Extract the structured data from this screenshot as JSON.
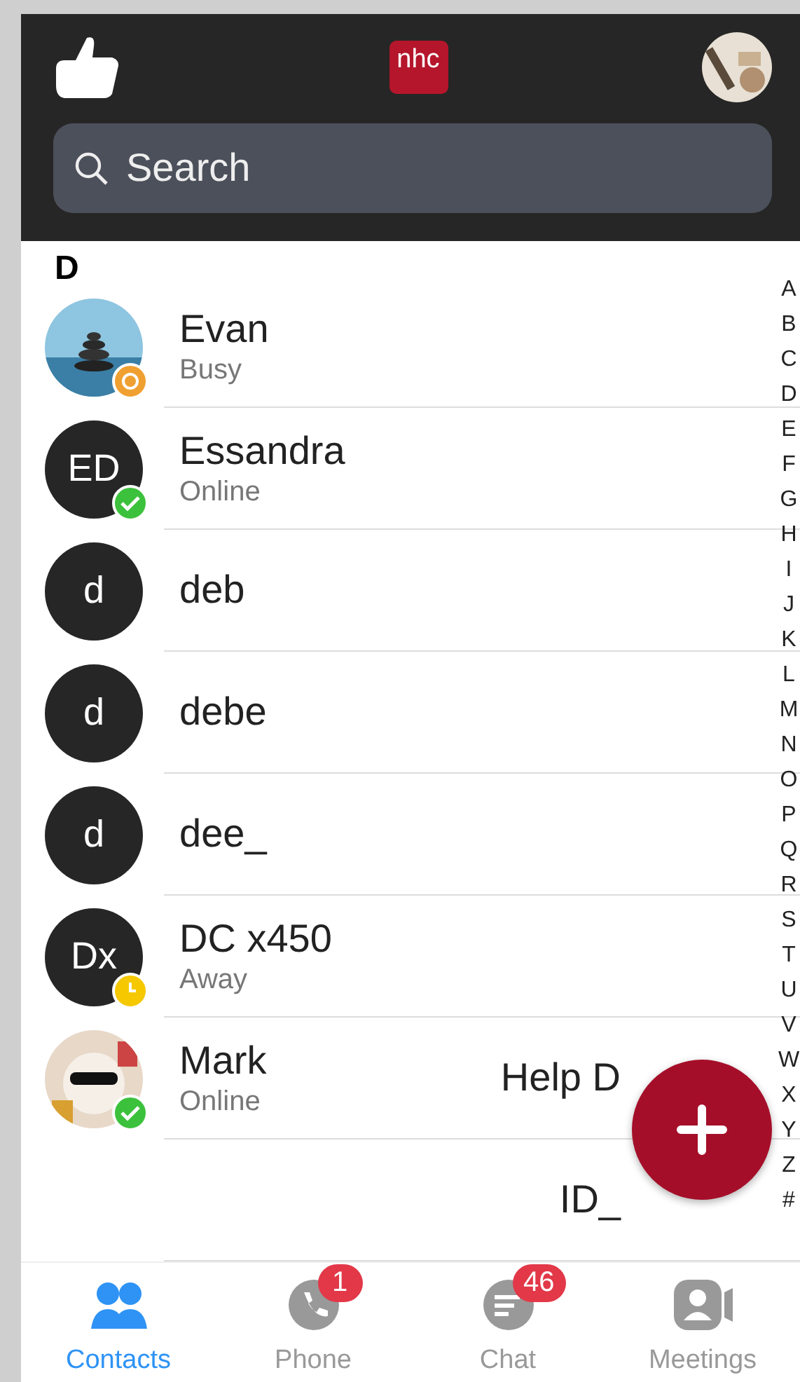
{
  "header": {
    "logo": "nhc",
    "search": {
      "placeholder": "Search"
    }
  },
  "section": "D",
  "contacts": [
    {
      "name": "Evan",
      "status": "Busy",
      "presence": {
        "kind": "busy",
        "color": "#f0a030"
      }
    },
    {
      "avatar": {
        "kind": "initials",
        "text": "ED"
      },
      "name": "Essandra",
      "status": "Online",
      "presence": {
        "kind": "online",
        "color": "#3cc13c"
      }
    },
    {
      "avatar": {
        "kind": "initials",
        "text": "d"
      },
      "name": "deb"
    },
    {
      "avatar": {
        "kind": "initials",
        "text": "d"
      },
      "name": "debe"
    },
    {
      "avatar": {
        "kind": "initials",
        "text": "d"
      },
      "name": "dee_"
    },
    {
      "avatar": {
        "kind": "initials",
        "text": "Dx"
      },
      "name": "DC x450",
      "status": "Away",
      "presence": {
        "kind": "away",
        "color": "#f5c800"
      }
    },
    {
      "name": "Mark",
      "status": "Online",
      "presence": {
        "kind": "online",
        "color": "#3cc13c"
      },
      "extra": "Help D"
    },
    {
      "extra": "ID_"
    }
  ],
  "index": [
    "A",
    "B",
    "C",
    "D",
    "E",
    "F",
    "G",
    "H",
    "I",
    "J",
    "K",
    "L",
    "M",
    "N",
    "O",
    "P",
    "Q",
    "R",
    "S",
    "T",
    "U",
    "V",
    "W",
    "X",
    "Y",
    "Z",
    "#"
  ],
  "tabs": [
    {
      "label": "Contacts",
      "selected": true
    },
    {
      "label": "Phone",
      "selected": false,
      "badge": "1"
    },
    {
      "label": "Chat",
      "selected": false,
      "badge": "46"
    },
    {
      "label": "Meetings",
      "selected": false
    }
  ]
}
